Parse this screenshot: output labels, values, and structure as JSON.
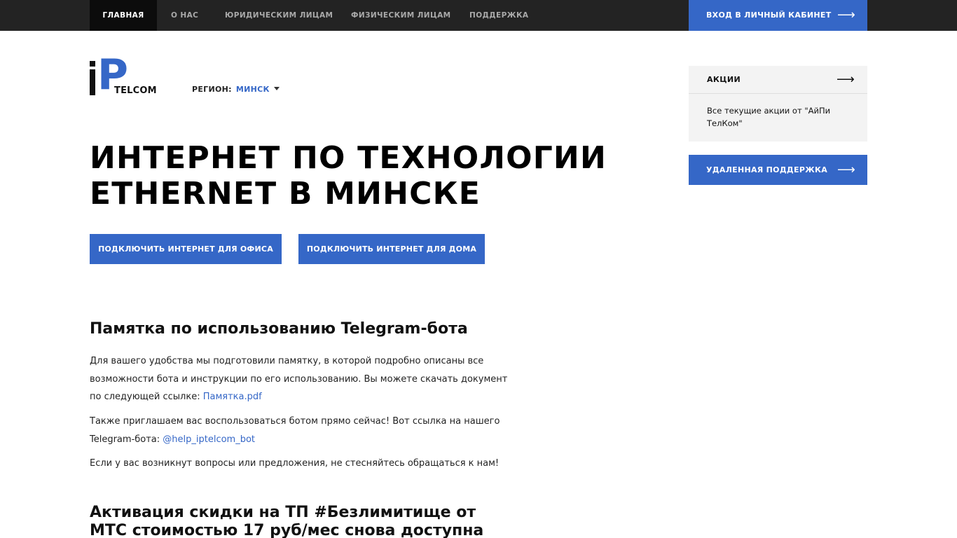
{
  "nav": {
    "items": [
      {
        "label": "ГЛАВНАЯ"
      },
      {
        "label": "О НАС"
      },
      {
        "label": "ЮРИДИЧЕСКИМ ЛИЦАМ"
      },
      {
        "label": "ФИЗИЧЕСКИМ ЛИЦАМ"
      },
      {
        "label": "ПОДДЕРЖКА"
      }
    ],
    "login": {
      "label": "ВХОД В ЛИЧНЫЙ КАБИНЕТ",
      "arrow": "⟶"
    }
  },
  "logo": {
    "i": "i",
    "p": "P",
    "telcom": "TELCOM"
  },
  "region": {
    "label": "РЕГИОН:",
    "value": "МИНСК"
  },
  "hero": {
    "title_line1": "ИНТЕРНЕТ ПО ТЕХНОЛОГИИ",
    "title_line2": "ETHERNET В МИНСКЕ",
    "btn_office": "ПОДКЛЮЧИТЬ ИНТЕРНЕТ ДЛЯ ОФИСА",
    "btn_home": "ПОДКЛЮЧИТЬ ИНТЕРНЕТ ДЛЯ ДОМА"
  },
  "articles": [
    {
      "title": "Памятка по использованию Telegram-бота",
      "p1_text": "Для вашего удобства мы подготовили памятку, в которой подробно описаны все возможности бота и инструкции по его использованию. Вы можете скачать документ по следующей ссылке: ",
      "p1_link": "Памятка.pdf",
      "p2_text": "Также приглашаем вас воспользоваться ботом прямо сейчас! Вот ссылка на нашего Telegram-бота: ",
      "p2_link": "@help_iptelcom_bot",
      "p3_text": "Если у вас возникнут вопросы или предложения, не стесняйтесь обращаться к нам!"
    },
    {
      "title": "Активация скидки на ТП #Безлимитище от МТС стоимостью 17 руб/мес снова доступна"
    }
  ],
  "sidebar": {
    "promo_title": "АКЦИИ",
    "promo_arrow": "⟶",
    "promo_text": "Все текущие акции от \"АйПи ТелКом\"",
    "support_label": "УДАЛЕННАЯ ПОДДЕРЖКА",
    "support_arrow": "⟶"
  },
  "colors": {
    "accent": "#3567c7",
    "nav_bg": "#232323",
    "nav_active_bg": "#0c0c0c",
    "sidebar_bg": "#f3f3f3"
  },
  "icons": {
    "arrow": "arrow-right-icon",
    "caret": "caret-down-icon"
  }
}
